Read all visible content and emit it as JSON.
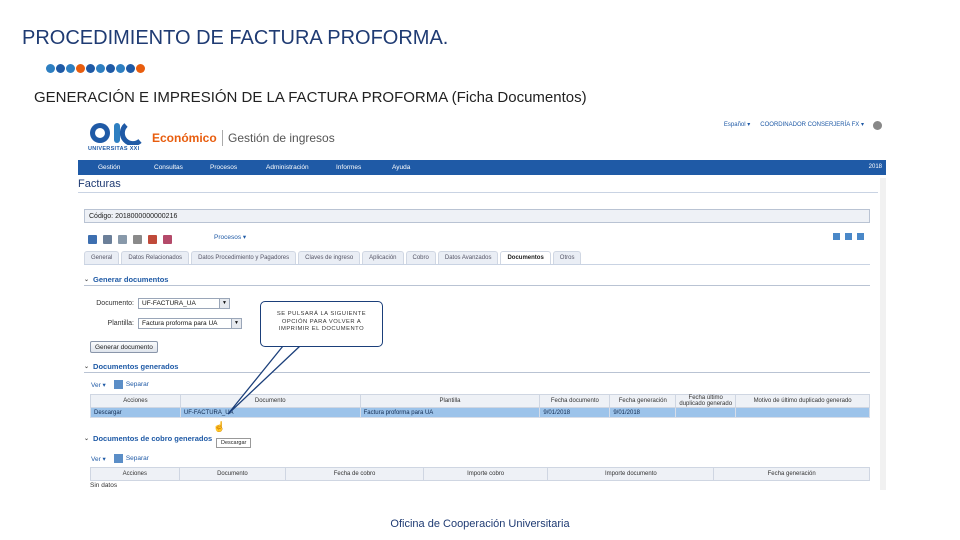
{
  "slide": {
    "title": "PROCEDIMIENTO DE FACTURA PROFORMA.",
    "subtitle": "GENERACIÓN E IMPRESIÓN DE LA FACTURA PROFORMA (Ficha Documentos)",
    "footer": "Oficina de Cooperación Universitaria",
    "dot_colors": [
      "#2e7fc1",
      "#1f5aa6",
      "#2e7fc1",
      "#e85d0e",
      "#1f5aa6",
      "#2e7fc1",
      "#1f5aa6",
      "#2e7fc1",
      "#1f5aa6",
      "#e85d0e"
    ]
  },
  "app": {
    "logo_text": "UNIVERSITAS XXI",
    "brand_module": "Económico",
    "brand_app": "Gestión de ingresos",
    "top_links": [
      "Español ▾",
      "COORDINADOR CONSERJERÍA FX ▾"
    ],
    "menu": [
      "Gestión",
      "Consultas",
      "Procesos",
      "Administración",
      "Informes",
      "Ayuda"
    ],
    "year": "2018",
    "page_title": "Facturas",
    "code_label": "Código: 2018000000000216",
    "process_menu": "Procesos ▾",
    "tabs": [
      "General",
      "Datos Relacionados",
      "Datos Procedimiento y Pagadores",
      "Claves de ingreso",
      "Aplicación",
      "Cobro",
      "Datos Avanzados",
      "Documentos",
      "Otros"
    ],
    "active_tab": "Documentos",
    "generate": {
      "header": "Generar documentos",
      "doc_label": "Documento:",
      "doc_value": "UF-FACTURA_UA",
      "tpl_label": "Plantilla:",
      "tpl_value": "Factura proforma para UA",
      "button": "Generar documento"
    },
    "generated": {
      "header": "Documentos generados",
      "tools": [
        "Ver ▾",
        "Separar"
      ],
      "columns": [
        "Acciones",
        "Documento",
        "Plantilla",
        "Fecha documento",
        "Fecha generación",
        "Fecha último duplicado generado",
        "Motivo de último duplicado generado"
      ],
      "row": [
        "Descargar",
        "UF-FACTURA_UA",
        "Factura proforma para UA",
        "9/01/2018",
        "9/01/2018",
        "",
        ""
      ]
    },
    "collection": {
      "header": "Documentos de cobro generados",
      "tools": [
        "Ver ▾",
        "Separar"
      ],
      "columns": [
        "Acciones",
        "Documento",
        "Fecha de cobro",
        "Importe cobro",
        "Importe documento",
        "Fecha generación"
      ],
      "empty": "Sin datos"
    },
    "tooltip": "Descargar"
  },
  "callout": {
    "text": "SE PULSARÁ LA SIGUIENTE OPCIÓN PARA VOLVER A IMPRIMIR EL DOCUMENTO"
  }
}
